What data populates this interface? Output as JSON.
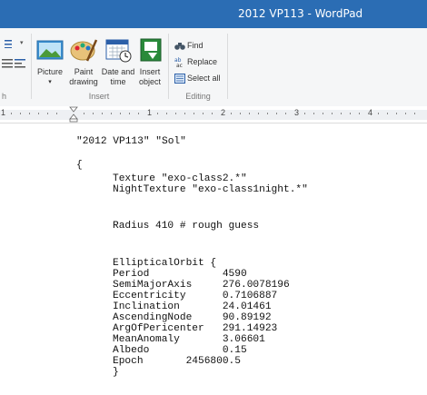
{
  "window": {
    "title": "2012 VP113 - WordPad"
  },
  "ribbon": {
    "left_partial_group_label": "h",
    "insert": {
      "label": "Insert",
      "picture_label": "Picture",
      "paint_label_1": "Paint",
      "paint_label_2": "drawing",
      "datetime_label_1": "Date and",
      "datetime_label_2": "time",
      "object_label_1": "Insert",
      "object_label_2": "object"
    },
    "editing": {
      "label": "Editing",
      "find_label": "Find",
      "replace_label": "Replace",
      "selectall_label": "Select all"
    }
  },
  "ruler": {
    "n1": "1",
    "n2": "1",
    "n3": "2",
    "n4": "3",
    "n5": "4"
  },
  "document": {
    "lines": [
      "\"2012 VP113\" \"Sol\"",
      "{",
      "Texture \"exo-class2.*\"",
      "NightTexture \"exo-class1night.*\"",
      "Radius 410 # rough guess",
      "EllipticalOrbit {",
      "Period            4590",
      "SemiMajorAxis     276.0078196",
      "Eccentricity      0.7106887",
      "Inclination       24.01461",
      "AscendingNode     90.89192",
      "ArgOfPericenter   291.14923",
      "MeanAnomaly       3.06601",
      "Albedo            0.15",
      "Epoch       2456800.5",
      "}"
    ]
  },
  "colors": {
    "titlebar": "#2b6db4",
    "ribbon_bg": "#f5f6f7"
  }
}
